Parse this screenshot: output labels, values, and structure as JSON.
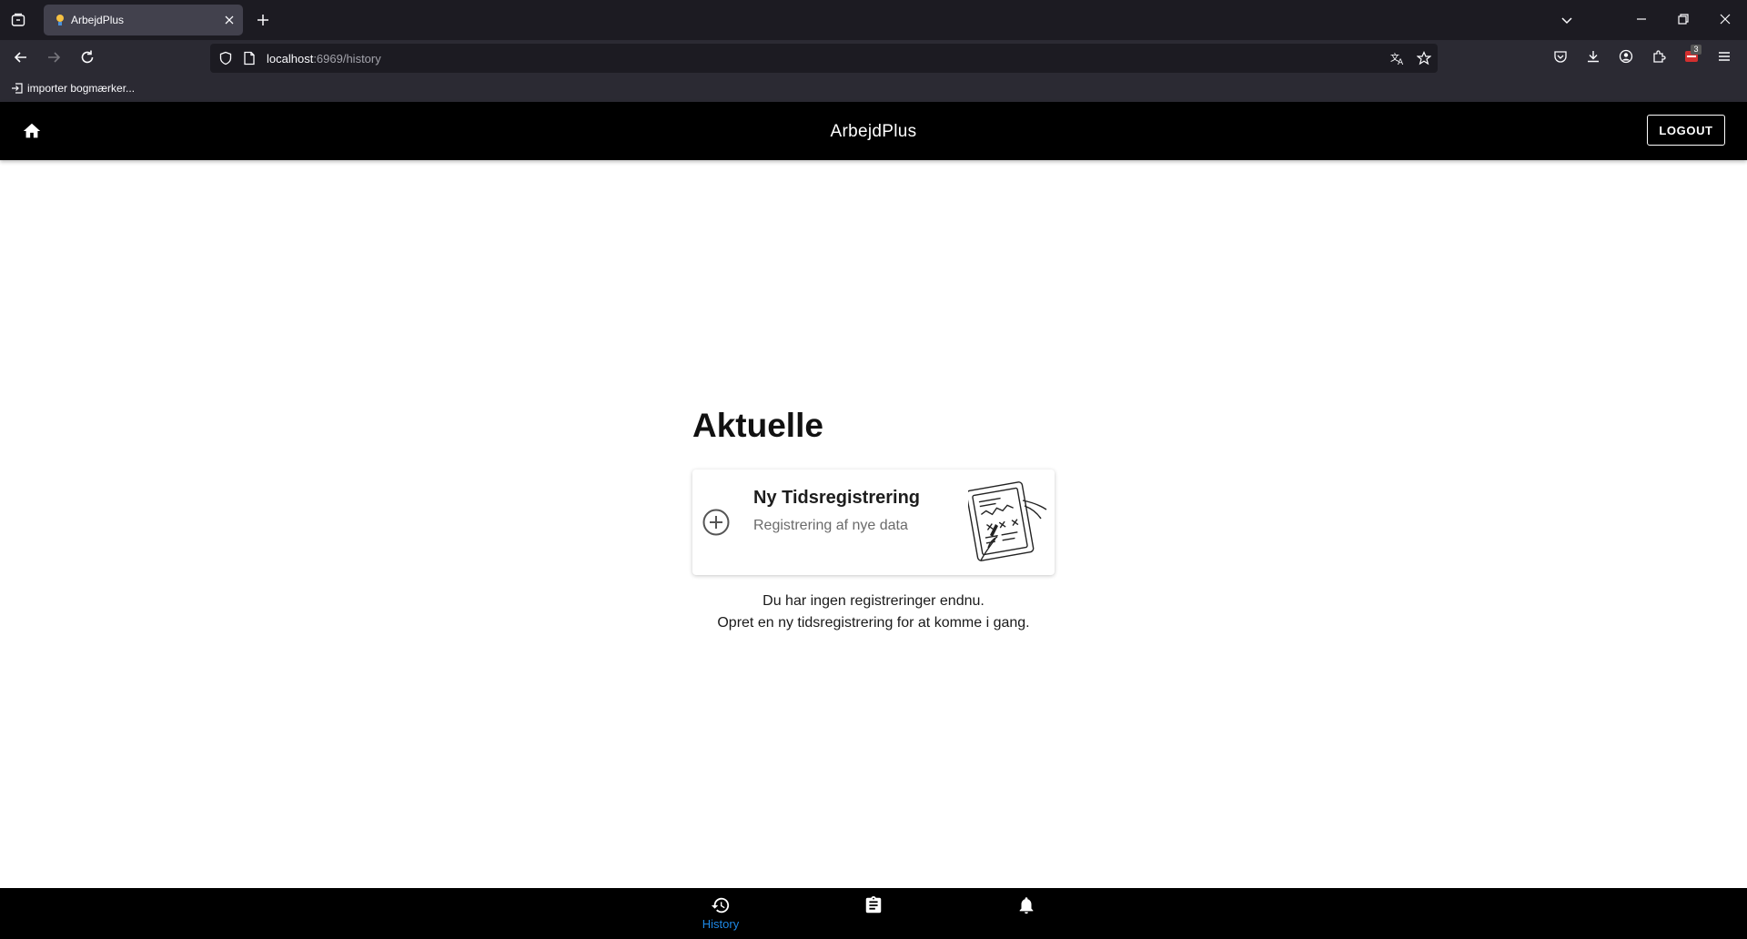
{
  "browser": {
    "tab_title": "ArbejdPlus",
    "url_host": "localhost",
    "url_path": ":6969/history",
    "bookmark_label": "importer bogmærker...",
    "extension_badge": "3"
  },
  "header": {
    "title": "ArbejdPlus",
    "logout_label": "LOGOUT"
  },
  "main": {
    "section_title": "Aktuelle",
    "card": {
      "title": "Ny Tidsregistrering",
      "subtitle": "Registrering af nye data"
    },
    "empty_state": {
      "line1": "Du har ingen registreringer endnu.",
      "line2": "Opret en ny tidsregistrering for at komme i gang."
    }
  },
  "bottom_nav": {
    "items": [
      {
        "icon": "history-icon",
        "label": "History",
        "active": true
      },
      {
        "icon": "clipboard-icon",
        "label": "",
        "active": false
      },
      {
        "icon": "bell-icon",
        "label": "",
        "active": false
      }
    ]
  },
  "colors": {
    "header_bg": "#000000",
    "active_nav": "#1e88e5",
    "chrome_bg": "#2b2a33",
    "tabbar_bg": "#1c1b22"
  }
}
